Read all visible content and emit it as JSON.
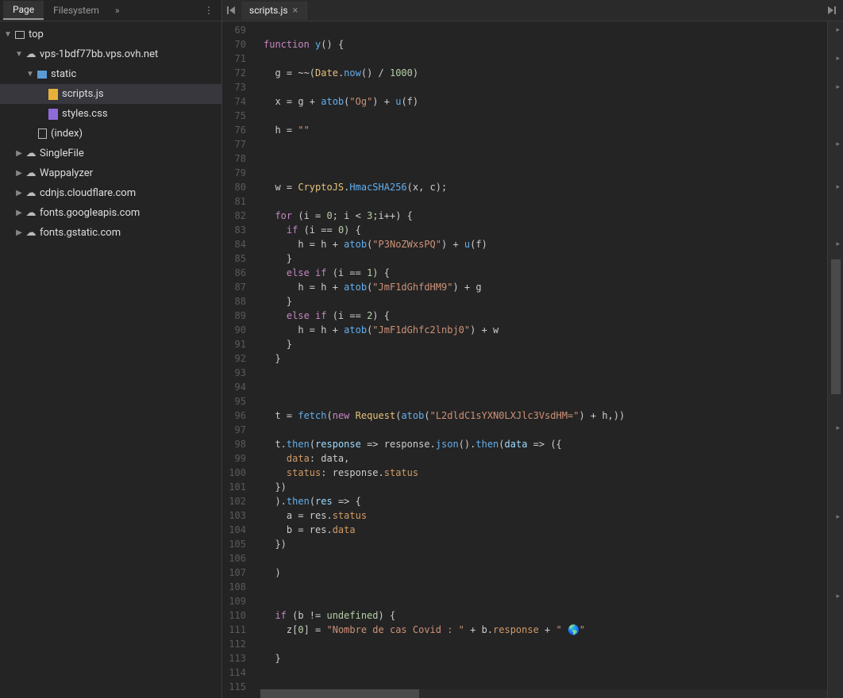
{
  "sidebar": {
    "tabs": {
      "page": "Page",
      "filesystem": "Filesystem"
    },
    "tree": {
      "top": "top",
      "domain": "vps-1bdf77bb.vps.ovh.net",
      "static": "static",
      "scripts": "scripts.js",
      "styles": "styles.css",
      "index": "(index)",
      "singlefile": "SingleFile",
      "wappalyzer": "Wappalyzer",
      "cdnjs": "cdnjs.cloudflare.com",
      "gfonts": "fonts.googleapis.com",
      "gstatic": "fonts.gstatic.com"
    }
  },
  "tabs": {
    "active": "scripts.js"
  },
  "editor": {
    "startLine": 69,
    "endLine": 115,
    "code": {
      "l70": {
        "kw": "function",
        "name": "y",
        "rest": "() {"
      },
      "l72": {
        "a": "g = ~~(",
        "date": "Date",
        "now": "now",
        "b": "() / ",
        "num": "1000",
        "c": ")"
      },
      "l74": {
        "a": "x = g + ",
        "atob": "atob",
        "s": "\"Og\"",
        "b": ") + ",
        "u": "u",
        "c": "(f)"
      },
      "l76": {
        "a": "h = ",
        "s": "\"\""
      },
      "l80": {
        "a": "w = ",
        "cj": "CryptoJS",
        "hm": "HmacSHA256",
        "b": "(x, c);"
      },
      "l82": {
        "kw": "for",
        "a": " (i = ",
        "z": "0",
        "b": "; i < ",
        "three": "3",
        "c": ";i++) {"
      },
      "l83": {
        "kw": "if",
        "a": " (i == ",
        "z": "0",
        "b": ") {"
      },
      "l84": {
        "a": "h = h + ",
        "atob": "atob",
        "s": "\"P3NoZWxsPQ\"",
        "b": ") + ",
        "u": "u",
        "c": "(f)"
      },
      "l86": {
        "kw": "else if",
        "a": " (i == ",
        "n": "1",
        "b": ") {"
      },
      "l87": {
        "a": "h = h + ",
        "atob": "atob",
        "s": "\"JmF1dGhfdHM9\"",
        "b": ") + g"
      },
      "l89": {
        "kw": "else if",
        "a": " (i == ",
        "n": "2",
        "b": ") {"
      },
      "l90": {
        "a": "h = h + ",
        "atob": "atob",
        "s": "\"JmF1dGhfc2lnbj0\"",
        "b": ") + w"
      },
      "l96": {
        "a": "t = ",
        "fetch": "fetch",
        "newk": "new",
        "req": "Request",
        "atob": "atob",
        "s": "\"L2dldC1sYXN0LXJlc3VsdHM=\"",
        "b": ") + h,))"
      },
      "l98": {
        "a": "t.",
        "then": "then",
        "r": "response",
        "b": " => ",
        "resp": "response",
        "json": "json",
        "c": "().",
        "then2": "then",
        "data": "data",
        "d": " => ({"
      },
      "l99": {
        "k": "data",
        "a": ": data,"
      },
      "l100": {
        "k": "status",
        "a": ": response.",
        "s": "status"
      },
      "l102": {
        "a": ").",
        "then": "then",
        "res": "res",
        "b": " => {"
      },
      "l103": {
        "a": "a = res.",
        "s": "status"
      },
      "l104": {
        "a": "b = res.",
        "d": "data"
      },
      "l110": {
        "kw": "if",
        "a": " (b != ",
        "u": "undefined",
        "b": ") {"
      },
      "l111": {
        "a": "z[",
        "z": "0",
        "b": "] = ",
        "s1": "\"Nombre de cas Covid : \"",
        "c": " + b.",
        "r": "response",
        "d": " + ",
        "s2": "\" 🌎\""
      }
    }
  }
}
